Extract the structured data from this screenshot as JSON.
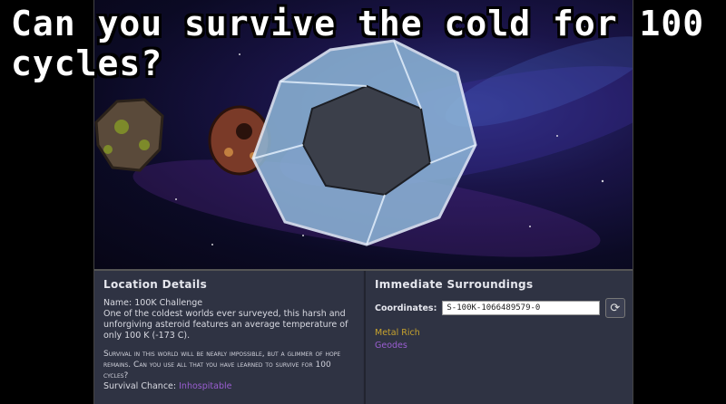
{
  "caption": "Can you survive the cold for 100 cycles?",
  "location": {
    "title": "Location Details",
    "name_line": "Name: 100K Challenge",
    "description": "One of the coldest worlds ever surveyed, this harsh and unforgiving asteroid features an average temperature of only 100 K (-173 C).",
    "flavor": "Survival in this world will be nearly impossible, but a glimmer of hope remains. Can you use all that you have learned to survive for 100 cycles?",
    "survival_label": "Survival Chance:",
    "survival_value": "Inhospitable"
  },
  "surroundings": {
    "title": "Immediate Surroundings",
    "coords_label": "Coordinates:",
    "coords_value": "S-100K-1066489579-0",
    "reroll_icon": "refresh-icon",
    "traits": [
      {
        "label": "Metal Rich",
        "color": "#c7a32e"
      },
      {
        "label": "Geodes",
        "color": "#9a5ed1"
      }
    ]
  },
  "colors": {
    "panel": "#2f3343",
    "accent_purple": "#9a5ed1",
    "accent_gold": "#c7a32e"
  }
}
